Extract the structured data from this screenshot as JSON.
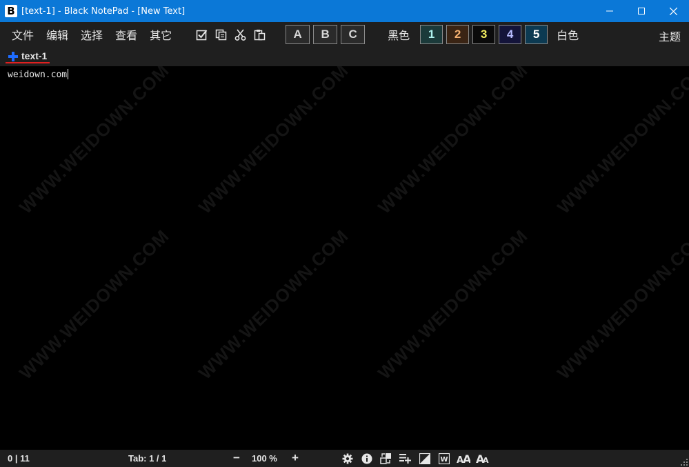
{
  "window": {
    "app_icon_letter": "B",
    "title": "[text-1] - Black NotePad - [New Text]"
  },
  "menu": [
    "文件",
    "编辑",
    "选择",
    "查看",
    "其它"
  ],
  "toolbar": {
    "font_buttons": [
      "A",
      "B",
      "C"
    ],
    "dark_label": "黑色",
    "light_label": "白色",
    "theme_label": "主题",
    "swatches": [
      {
        "label": "1",
        "bg": "#1b3a3a",
        "fg": "#aef2ee"
      },
      {
        "label": "2",
        "bg": "#3a2414",
        "fg": "#f5b070"
      },
      {
        "label": "3",
        "bg": "#0a0a0a",
        "fg": "#f5f060"
      },
      {
        "label": "4",
        "bg": "#14143a",
        "fg": "#b8bcff"
      },
      {
        "label": "5",
        "bg": "#0c3a52",
        "fg": "#ffffff"
      }
    ]
  },
  "tabs": [
    {
      "label": "text-1",
      "active": true
    }
  ],
  "editor": {
    "content": "weidown.com"
  },
  "watermark_text": "WWW.WEIDOWN.COM",
  "status": {
    "position": "0 | 11",
    "tab": "Tab: 1 / 1",
    "zoom_minus": "−",
    "zoom": "100 %",
    "zoom_plus": "+"
  },
  "colors": {
    "titlebar": "#0b78d7",
    "chrome": "#1f1f1f",
    "editor_bg": "#000000",
    "tab_underline": "#e02020",
    "plus_icon": "#1e6cff"
  }
}
